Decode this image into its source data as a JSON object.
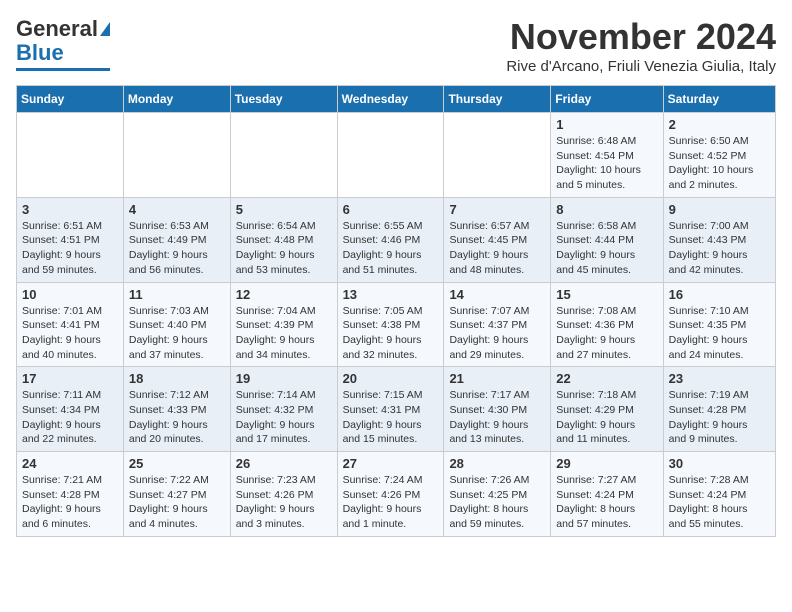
{
  "header": {
    "logo_general": "General",
    "logo_blue": "Blue",
    "month_title": "November 2024",
    "location": "Rive d'Arcano, Friuli Venezia Giulia, Italy"
  },
  "weekdays": [
    "Sunday",
    "Monday",
    "Tuesday",
    "Wednesday",
    "Thursday",
    "Friday",
    "Saturday"
  ],
  "weeks": [
    [
      {
        "day": "",
        "info": ""
      },
      {
        "day": "",
        "info": ""
      },
      {
        "day": "",
        "info": ""
      },
      {
        "day": "",
        "info": ""
      },
      {
        "day": "",
        "info": ""
      },
      {
        "day": "1",
        "info": "Sunrise: 6:48 AM\nSunset: 4:54 PM\nDaylight: 10 hours\nand 5 minutes."
      },
      {
        "day": "2",
        "info": "Sunrise: 6:50 AM\nSunset: 4:52 PM\nDaylight: 10 hours\nand 2 minutes."
      }
    ],
    [
      {
        "day": "3",
        "info": "Sunrise: 6:51 AM\nSunset: 4:51 PM\nDaylight: 9 hours\nand 59 minutes."
      },
      {
        "day": "4",
        "info": "Sunrise: 6:53 AM\nSunset: 4:49 PM\nDaylight: 9 hours\nand 56 minutes."
      },
      {
        "day": "5",
        "info": "Sunrise: 6:54 AM\nSunset: 4:48 PM\nDaylight: 9 hours\nand 53 minutes."
      },
      {
        "day": "6",
        "info": "Sunrise: 6:55 AM\nSunset: 4:46 PM\nDaylight: 9 hours\nand 51 minutes."
      },
      {
        "day": "7",
        "info": "Sunrise: 6:57 AM\nSunset: 4:45 PM\nDaylight: 9 hours\nand 48 minutes."
      },
      {
        "day": "8",
        "info": "Sunrise: 6:58 AM\nSunset: 4:44 PM\nDaylight: 9 hours\nand 45 minutes."
      },
      {
        "day": "9",
        "info": "Sunrise: 7:00 AM\nSunset: 4:43 PM\nDaylight: 9 hours\nand 42 minutes."
      }
    ],
    [
      {
        "day": "10",
        "info": "Sunrise: 7:01 AM\nSunset: 4:41 PM\nDaylight: 9 hours\nand 40 minutes."
      },
      {
        "day": "11",
        "info": "Sunrise: 7:03 AM\nSunset: 4:40 PM\nDaylight: 9 hours\nand 37 minutes."
      },
      {
        "day": "12",
        "info": "Sunrise: 7:04 AM\nSunset: 4:39 PM\nDaylight: 9 hours\nand 34 minutes."
      },
      {
        "day": "13",
        "info": "Sunrise: 7:05 AM\nSunset: 4:38 PM\nDaylight: 9 hours\nand 32 minutes."
      },
      {
        "day": "14",
        "info": "Sunrise: 7:07 AM\nSunset: 4:37 PM\nDaylight: 9 hours\nand 29 minutes."
      },
      {
        "day": "15",
        "info": "Sunrise: 7:08 AM\nSunset: 4:36 PM\nDaylight: 9 hours\nand 27 minutes."
      },
      {
        "day": "16",
        "info": "Sunrise: 7:10 AM\nSunset: 4:35 PM\nDaylight: 9 hours\nand 24 minutes."
      }
    ],
    [
      {
        "day": "17",
        "info": "Sunrise: 7:11 AM\nSunset: 4:34 PM\nDaylight: 9 hours\nand 22 minutes."
      },
      {
        "day": "18",
        "info": "Sunrise: 7:12 AM\nSunset: 4:33 PM\nDaylight: 9 hours\nand 20 minutes."
      },
      {
        "day": "19",
        "info": "Sunrise: 7:14 AM\nSunset: 4:32 PM\nDaylight: 9 hours\nand 17 minutes."
      },
      {
        "day": "20",
        "info": "Sunrise: 7:15 AM\nSunset: 4:31 PM\nDaylight: 9 hours\nand 15 minutes."
      },
      {
        "day": "21",
        "info": "Sunrise: 7:17 AM\nSunset: 4:30 PM\nDaylight: 9 hours\nand 13 minutes."
      },
      {
        "day": "22",
        "info": "Sunrise: 7:18 AM\nSunset: 4:29 PM\nDaylight: 9 hours\nand 11 minutes."
      },
      {
        "day": "23",
        "info": "Sunrise: 7:19 AM\nSunset: 4:28 PM\nDaylight: 9 hours\nand 9 minutes."
      }
    ],
    [
      {
        "day": "24",
        "info": "Sunrise: 7:21 AM\nSunset: 4:28 PM\nDaylight: 9 hours\nand 6 minutes."
      },
      {
        "day": "25",
        "info": "Sunrise: 7:22 AM\nSunset: 4:27 PM\nDaylight: 9 hours\nand 4 minutes."
      },
      {
        "day": "26",
        "info": "Sunrise: 7:23 AM\nSunset: 4:26 PM\nDaylight: 9 hours\nand 3 minutes."
      },
      {
        "day": "27",
        "info": "Sunrise: 7:24 AM\nSunset: 4:26 PM\nDaylight: 9 hours\nand 1 minute."
      },
      {
        "day": "28",
        "info": "Sunrise: 7:26 AM\nSunset: 4:25 PM\nDaylight: 8 hours\nand 59 minutes."
      },
      {
        "day": "29",
        "info": "Sunrise: 7:27 AM\nSunset: 4:24 PM\nDaylight: 8 hours\nand 57 minutes."
      },
      {
        "day": "30",
        "info": "Sunrise: 7:28 AM\nSunset: 4:24 PM\nDaylight: 8 hours\nand 55 minutes."
      }
    ]
  ]
}
